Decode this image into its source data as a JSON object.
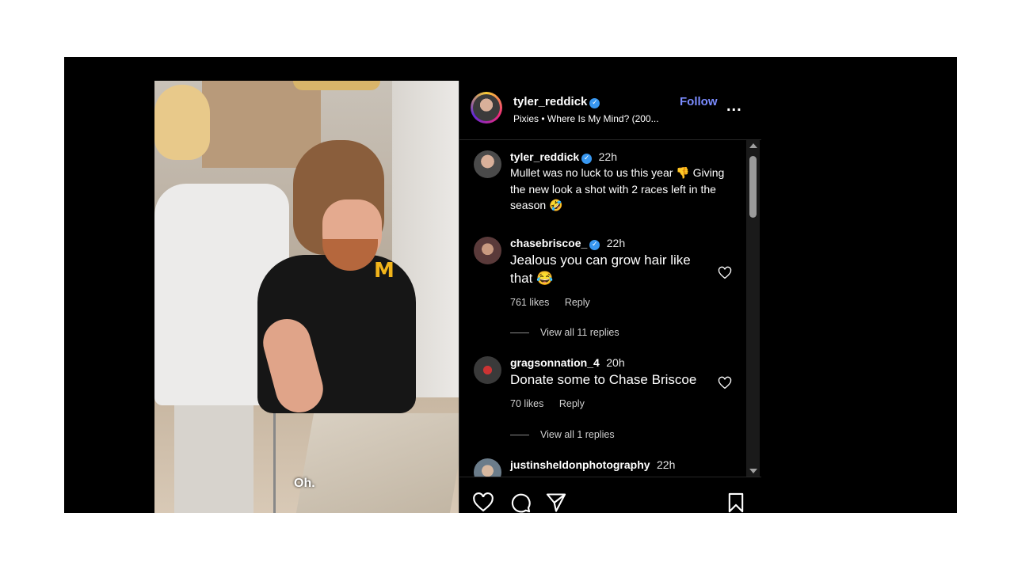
{
  "video": {
    "caption": "Oh."
  },
  "header": {
    "username": "tyler_reddick",
    "verified": "✓",
    "song": "Pixies • Where Is My Mind? (200...",
    "follow_label": "Follow",
    "more_label": "..."
  },
  "comments": [
    {
      "username": "tyler_reddick",
      "time": "22h",
      "text": "Mullet was no luck to us this year 👎 Giving the new look a shot with 2 races left in the season 🤣"
    },
    {
      "username": "chasebriscoe_",
      "time": "22h",
      "text": "Jealous you can grow hair like that 😂",
      "likes": "761 likes",
      "reply": "Reply",
      "view_replies": "View all 11 replies"
    },
    {
      "username": "gragsonnation_4",
      "time": "20h",
      "text": "Donate some to Chase Briscoe",
      "likes": "70 likes",
      "reply": "Reply",
      "view_replies": "View all 1 replies"
    },
    {
      "username": "justinsheldonphotography",
      "time": "22h"
    }
  ],
  "icons": {
    "like": "heart-icon",
    "comment": "comment-icon",
    "share": "send-icon",
    "save": "bookmark-icon"
  },
  "colors": {
    "follow": "#7b8cff",
    "verified": "#3897f0",
    "background": "#000000"
  }
}
